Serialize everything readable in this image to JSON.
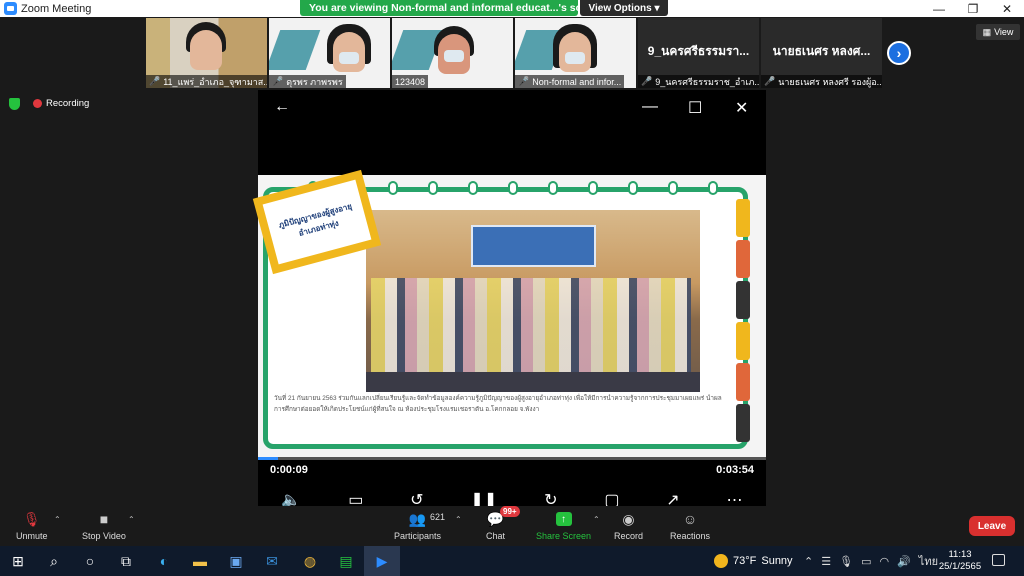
{
  "window": {
    "title": "Zoom Meeting",
    "minimize": "—",
    "maximize": "❐",
    "close": "✕"
  },
  "banner": {
    "text": "You are viewing Non-formal and informal educat...'s screen",
    "view_options": "View Options ▾"
  },
  "thumbnails": [
    {
      "caption": "11_แพร่_อำเภอ_จุฑามาส...",
      "big": ""
    },
    {
      "caption": "ดุรพร ภาพรพร",
      "big": ""
    },
    {
      "caption": "123408",
      "big": ""
    },
    {
      "caption": "Non-formal and infor...",
      "big": ""
    },
    {
      "caption": "9_นครศรีธรรมราช_อำเภ...",
      "big": "9_นครศรีธรรมรา..."
    },
    {
      "caption": "นายธเนศร หลงศรี รองผู้อ...",
      "big": "นายธเนศร หลงศ..."
    }
  ],
  "next_button": "›",
  "view_button": "View",
  "status": {
    "recording": "Recording"
  },
  "share": {
    "back": "←",
    "minimize": "—",
    "maximize": "☐",
    "close": "✕",
    "stamp_text": "ภูมิปัญญาของผู้สูงอายุ อำเภอท่าทุ่ง",
    "caption": "วันที่ 21 กันยายน 2563 ร่วมกันแลกเปลี่ยนเรียนรู้และจัดทำข้อมูลองค์ความรู้ภูมิปัญญาของผู้สูงอายุอำเภอท่าทุ่ง เพื่อให้มีการนำความรู้จากการประชุมมาเผยแพร่ นำผลการศึกษาต่อยอดให้เกิดประโยชน์แก่ผู้ที่สนใจ ณ ห้องประชุมโรงแรมเชอราตัน อ.โคกกลอย จ.พังงา",
    "elapsed": "0:00:09",
    "duration": "0:03:54",
    "progress": 0.04
  },
  "toolbar": {
    "unmute": "Unmute",
    "stop_video": "Stop Video",
    "participants": "Participants",
    "participants_count": "621",
    "chat": "Chat",
    "chat_badge": "99+",
    "share_screen": "Share Screen",
    "record": "Record",
    "reactions": "Reactions",
    "leave": "Leave"
  },
  "taskbar": {
    "temperature": "73°F",
    "weather": "Sunny",
    "language": "ไทย",
    "time": "11:13",
    "date": "25/1/2565"
  },
  "colors": {
    "zoom_blue": "#2d8cff",
    "banner_green": "#23a84a",
    "leave_red": "#d9302f",
    "slide_green": "#27a36a",
    "stamp_yellow": "#f0b71d"
  }
}
